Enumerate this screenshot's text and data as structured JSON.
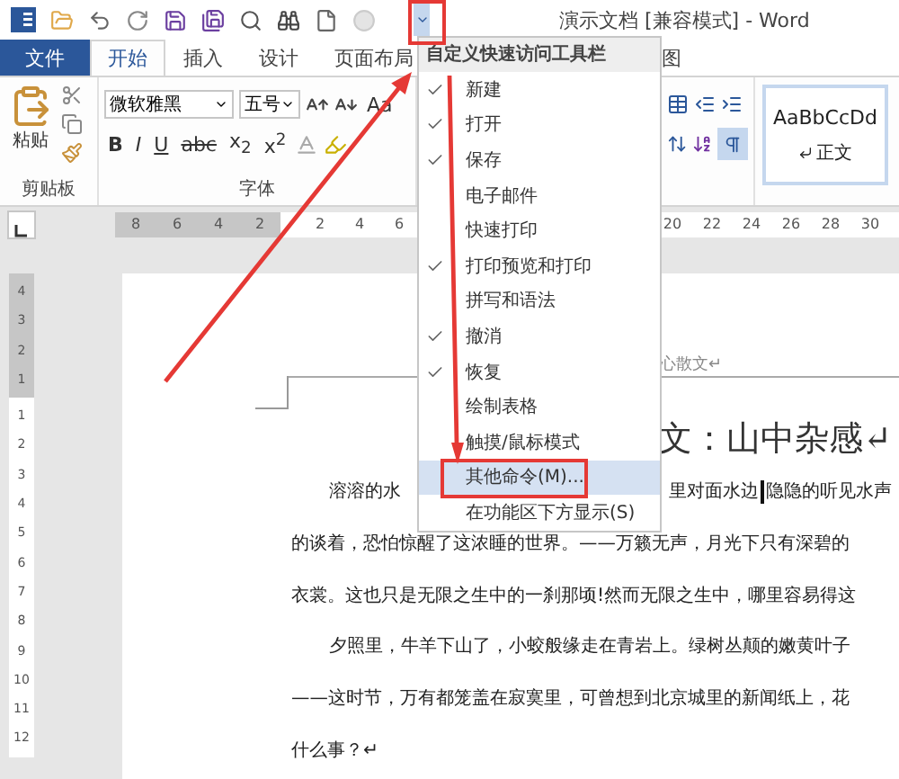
{
  "title_bar": {
    "title": "演示文档 [兼容模式] - Word",
    "customize_open": true
  },
  "tabs": [
    {
      "label": "文件",
      "kind": "file",
      "selected": false
    },
    {
      "label": "开始",
      "kind": "tab",
      "selected": true
    },
    {
      "label": "插入",
      "kind": "tab",
      "selected": false
    },
    {
      "label": "设计",
      "kind": "tab",
      "selected": false
    },
    {
      "label": "页面布局",
      "kind": "tab",
      "selected": false
    },
    {
      "label": "图",
      "kind": "tab",
      "selected": false
    }
  ],
  "ribbon": {
    "clipboard": {
      "paste": "粘贴",
      "group_label": "剪贴板"
    },
    "font": {
      "font_name": "微软雅黑",
      "font_size": "五号",
      "change_case": "Aa",
      "bold": "B",
      "italic": "I",
      "underline": "U",
      "strikethrough": "abc",
      "subscript": "x$_{2}$",
      "superscript": "x$^{2}$",
      "group_label": "字体"
    },
    "paragraph": {
      "show_marks_selected": true
    },
    "styles": [
      {
        "sample": "AaBbCcDd",
        "name": "正文",
        "selected": true
      }
    ]
  },
  "horizontal_ruler": {
    "left_numbers": [
      "8",
      "6",
      "4",
      "2"
    ],
    "middle_numbers": [
      "2",
      "4",
      "6"
    ],
    "right_numbers": [
      "20",
      "22",
      "24",
      "26",
      "28",
      "30"
    ]
  },
  "vertical_ruler": {
    "top_numbers": [
      "4",
      "3",
      "2",
      "1"
    ],
    "numbers": [
      "1",
      "2",
      "3",
      "4",
      "5",
      "6",
      "7",
      "8",
      "9",
      "10",
      "11",
      "12"
    ]
  },
  "qat_menu": {
    "title": "自定义快速访问工具栏",
    "items": [
      {
        "label": "新建",
        "checked": true,
        "selected": false
      },
      {
        "label": "打开",
        "checked": true,
        "selected": false
      },
      {
        "label": "保存",
        "checked": true,
        "selected": false
      },
      {
        "label": "电子邮件",
        "checked": false,
        "selected": false
      },
      {
        "label": "快速打印",
        "checked": false,
        "selected": false
      },
      {
        "label": "打印预览和打印",
        "checked": true,
        "selected": false
      },
      {
        "label": "拼写和语法",
        "checked": false,
        "selected": false
      },
      {
        "label": "撤消",
        "checked": true,
        "selected": false
      },
      {
        "label": "恢复",
        "checked": true,
        "selected": false
      },
      {
        "label": "绘制表格",
        "checked": false,
        "selected": false
      },
      {
        "label": "触摸/鼠标模式",
        "checked": false,
        "selected": false
      },
      {
        "label": "其他命令(M)...",
        "checked": false,
        "selected": true
      },
      {
        "label": "在功能区下方显示(S)",
        "checked": false,
        "selected": false
      }
    ]
  },
  "document": {
    "header": "心散文↵",
    "title": "文：山中杂感↵",
    "first_line": {
      "left": "溶溶的水",
      "right": "里对面水边",
      "after_cursor": "隐隐的听见水声"
    },
    "lines": [
      {
        "text": "的谈着，恐怕惊醒了这浓睡的世界。——万籁无声，月光下只有深碧的",
        "indent": false
      },
      {
        "text": "衣裳。这也只是无限之生中的一刹那顷!然而无限之生中，哪里容易得这",
        "indent": false
      },
      {
        "text": "夕照里，牛羊下山了，小蛟般缘走在青岩上。绿树丛颠的嫩黄叶子",
        "indent": true
      },
      {
        "text": "——这时节，万有都笼盖在寂寞里，可曾想到北京城里的新闻纸上，花",
        "indent": false
      },
      {
        "text": "什么事？↵",
        "indent": false
      }
    ]
  }
}
